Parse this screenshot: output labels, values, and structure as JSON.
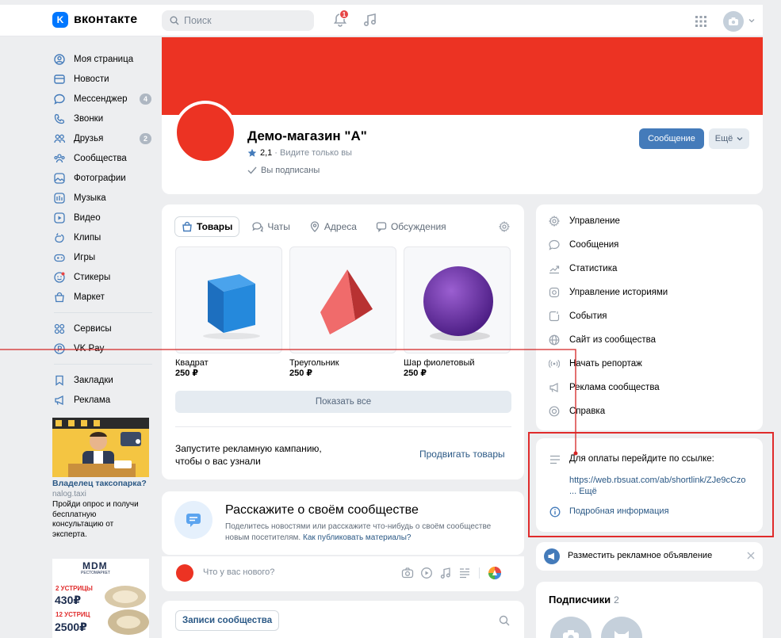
{
  "header": {
    "logo_text": "вконтакте",
    "search_placeholder": "Поиск",
    "notification_count": "1"
  },
  "sidebar": {
    "items": [
      {
        "label": "Моя страница"
      },
      {
        "label": "Новости"
      },
      {
        "label": "Мессенджер",
        "count": "4"
      },
      {
        "label": "Звонки"
      },
      {
        "label": "Друзья",
        "count": "2"
      },
      {
        "label": "Сообщества"
      },
      {
        "label": "Фотографии"
      },
      {
        "label": "Музыка"
      },
      {
        "label": "Видео"
      },
      {
        "label": "Клипы"
      },
      {
        "label": "Игры"
      },
      {
        "label": "Стикеры"
      },
      {
        "label": "Маркет"
      }
    ],
    "items2": [
      {
        "label": "Сервисы"
      },
      {
        "label": "VK Pay"
      }
    ],
    "items3": [
      {
        "label": "Закладки"
      },
      {
        "label": "Реклама"
      }
    ],
    "ad1": {
      "title": "Владелец таксопарка?",
      "source": "nalog.taxi",
      "text": "Пройди опрос и получи бесплатную консультацию от эксперта."
    },
    "ad2": {
      "brand": "MDM",
      "brand_sub": "РЕСТОМАРКЕТ",
      "line1": "2 УСТРИЦЫ",
      "price1": "430₽",
      "line2": "12 УСТРИЦ",
      "price2": "2500₽"
    }
  },
  "profile": {
    "name": "Демо-магазин \"А\"",
    "rating": "2,1",
    "rating_note": "· Видите только вы",
    "subscribed": "Вы подписаны",
    "message_button": "Сообщение",
    "more_button": "Ещё"
  },
  "shop": {
    "tabs": [
      "Товары",
      "Чаты",
      "Адреса",
      "Обсуждения"
    ],
    "products": [
      {
        "name": "Квадрат",
        "price": "250 ₽"
      },
      {
        "name": "Треугольник",
        "price": "250 ₽"
      },
      {
        "name": "Шар фиолетовый",
        "price": "250 ₽"
      }
    ],
    "show_all": "Показать все",
    "promo_text": "Запустите рекламную кампанию, чтобы о вас узнали",
    "promo_link": "Продвигать товары"
  },
  "tell": {
    "title": "Расскажите о своём сообществе",
    "desc": "Поделитесь новостями или расскажите что-нибудь о своём сообществе новым посетителям.",
    "link": "Как публиковать материалы?"
  },
  "post": {
    "placeholder": "Что у вас нового?"
  },
  "wall": {
    "button": "Записи сообщества"
  },
  "manage": {
    "items": [
      {
        "label": "Управление",
        "icon": "gear-icon"
      },
      {
        "label": "Сообщения",
        "icon": "message-icon"
      },
      {
        "label": "Статистика",
        "icon": "chart-icon"
      },
      {
        "label": "Управление историями",
        "icon": "stories-icon"
      },
      {
        "label": "События",
        "icon": "event-icon"
      },
      {
        "label": "Сайт из сообщества",
        "icon": "globe-icon"
      },
      {
        "label": "Начать репортаж",
        "icon": "broadcast-icon"
      },
      {
        "label": "Реклама сообщества",
        "icon": "megaphone-icon"
      },
      {
        "label": "Справка",
        "icon": "help-icon"
      }
    ]
  },
  "payinfo": {
    "text": "Для оплаты перейдите по ссылке:",
    "link": "https://web.rbsuat.com/ab/shortlink/ZJe9cCzo",
    "more": "... Ещё",
    "details": "Подробная информация"
  },
  "adplace": {
    "text": "Разместить рекламное объявление"
  },
  "subs": {
    "title": "Подписчики",
    "count": "2"
  },
  "colors": {
    "accent": "#447bba",
    "cover": "#ec3323",
    "highlight": "#e02b2b"
  }
}
